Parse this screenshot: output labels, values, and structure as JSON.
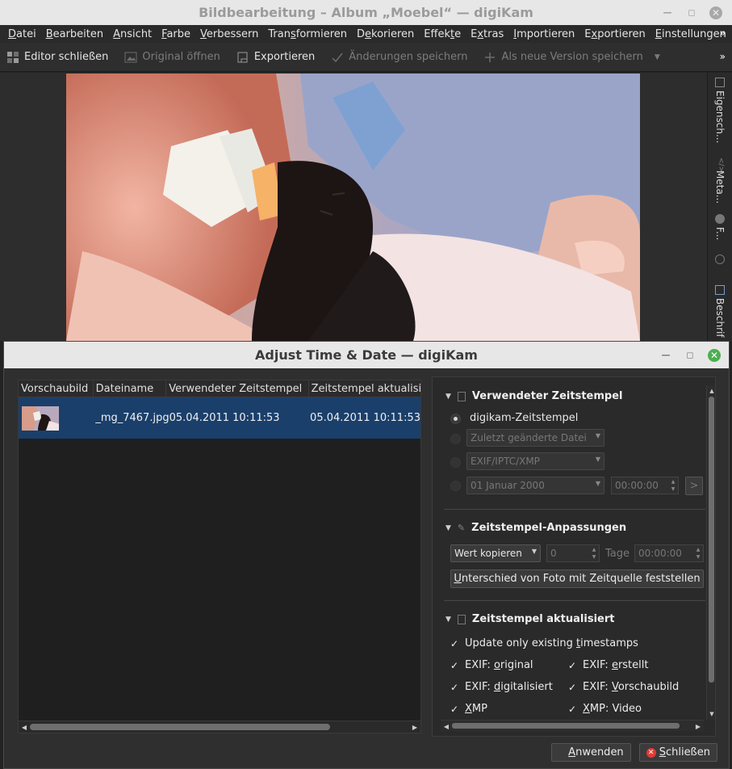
{
  "main_window": {
    "title": "Bildbearbeitung – Album „Moebel“ — digiKam"
  },
  "menubar": {
    "items": [
      {
        "pre": "",
        "u": "D",
        "post": "atei"
      },
      {
        "pre": "",
        "u": "B",
        "post": "earbeiten"
      },
      {
        "pre": "",
        "u": "A",
        "post": "nsicht"
      },
      {
        "pre": "",
        "u": "F",
        "post": "arbe"
      },
      {
        "pre": "",
        "u": "V",
        "post": "erbessern"
      },
      {
        "pre": "Tran",
        "u": "s",
        "post": "formieren"
      },
      {
        "pre": "D",
        "u": "e",
        "post": "korieren"
      },
      {
        "pre": "Effek",
        "u": "t",
        "post": "e"
      },
      {
        "pre": "E",
        "u": "x",
        "post": "tras"
      },
      {
        "pre": "",
        "u": "I",
        "post": "mportieren"
      },
      {
        "pre": "E",
        "u": "x",
        "post": "portieren"
      },
      {
        "pre": "",
        "u": "E",
        "post": "instellungen"
      }
    ],
    "overflow": "»"
  },
  "toolbar": {
    "close_editor": "Editor schließen",
    "open_original": "Original öffnen",
    "export": "Exportieren",
    "save_changes": "Änderungen speichern",
    "save_new_version": "Als neue Version speichern",
    "overflow": "»"
  },
  "right_sidebar": {
    "tabs": [
      "Eigensch...",
      "Meta...",
      "F...",
      "Beschrif"
    ]
  },
  "dialog": {
    "title": "Adjust Time & Date — digiKam",
    "list": {
      "columns": [
        "Vorschaubild",
        "Dateiname",
        "Verwendeter Zeitstempel",
        "Zeitstempel aktualisier"
      ],
      "rows": [
        {
          "filename": "_mg_7467.jpg",
          "used_timestamp": "05.04.2011 10:11:53",
          "updated_timestamp": "05.04.2011 10:11:53"
        }
      ]
    },
    "used_ts": {
      "header": "Verwendeter Zeitstempel",
      "option_digikam": "digikam-Zeitstempel",
      "option_file": "Zuletzt geänderte Datei",
      "option_meta": "EXIF/IPTC/XMP",
      "custom_date": "01 Januar 2000",
      "custom_time": "00:00:00"
    },
    "adjust": {
      "header": "Zeitstempel-Anpassungen",
      "mode": "Wert kopieren",
      "days_value": "0",
      "days_label": "Tage",
      "time_value": "00:00:00",
      "diff_button_pre": "",
      "diff_button_u": "U",
      "diff_button_post": "nterschied von Foto mit Zeitquelle feststellen"
    },
    "updated": {
      "header": "Zeitstempel aktualisiert",
      "only_existing_pre": "Update only existing ",
      "only_existing_u": "t",
      "only_existing_post": "imestamps",
      "exif_original_pre": "EXIF: ",
      "exif_original_u": "o",
      "exif_original_post": "riginal",
      "exif_created_pre": "EXIF: ",
      "exif_created_u": "e",
      "exif_created_post": "rstellt",
      "exif_digitized_pre": "EXIF: ",
      "exif_digitized_u": "d",
      "exif_digitized_post": "igitalisiert",
      "exif_thumb_pre": "EXIF: ",
      "exif_thumb_u": "V",
      "exif_thumb_post": "orschaubild",
      "xmp_pre": "",
      "xmp_u": "X",
      "xmp_post": "MP",
      "xmp_video_pre": "",
      "xmp_video_u": "X",
      "xmp_video_post": "MP: Video"
    },
    "buttons": {
      "apply_pre": "",
      "apply_u": "A",
      "apply_post": "nwenden",
      "close_pre": "",
      "close_u": "S",
      "close_post": "chließen"
    }
  }
}
